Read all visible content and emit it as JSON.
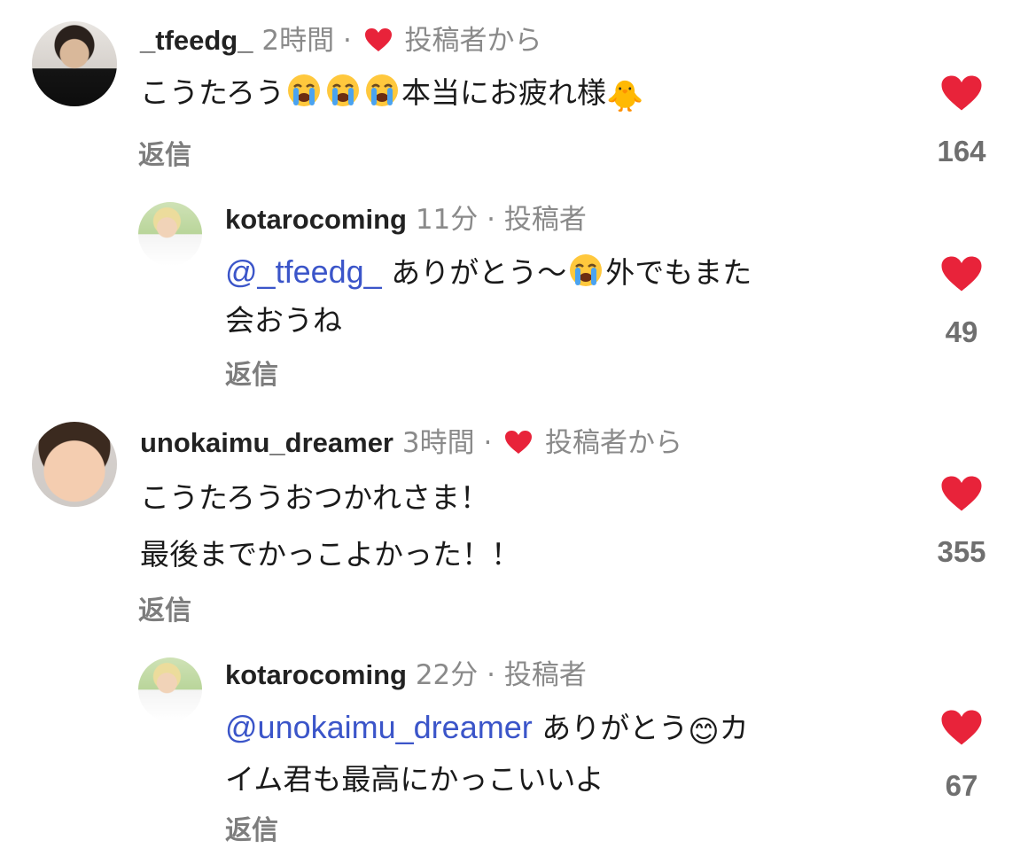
{
  "colors": {
    "heart": "#e8233a",
    "mention": "#3b55c9",
    "meta": "#8a8a8a"
  },
  "comments": [
    {
      "username": "_tfeedg_",
      "time": "2時間",
      "separator": "·",
      "creator_badge": "投稿者から",
      "text_before": "こうたろう",
      "text_after": "本当にお疲れ様",
      "emoji_tail": "🐥",
      "reply_label": "返信",
      "likes": "164"
    },
    {
      "username": "kotarocoming",
      "time": "11分",
      "separator": "·",
      "author_tag": "投稿者",
      "mention": "@_tfeedg_",
      "text_line1_a": "ありがとう〜",
      "text_line1_b": "外でもまた",
      "text_line2": "会おうね",
      "reply_label": "返信",
      "likes": "49"
    },
    {
      "username": "unokaimu_dreamer",
      "time": "3時間",
      "separator": "·",
      "creator_badge": "投稿者から",
      "text_line1": "こうたろうおつかれさま！",
      "text_line2": "最後までかっこよかった！！",
      "reply_label": "返信",
      "likes": "355"
    },
    {
      "username": "kotarocoming",
      "time": "22分",
      "separator": "·",
      "author_tag": "投稿者",
      "mention": "@unokaimu_dreamer",
      "text_line1_a": "ありがとう",
      "emoji": "😊",
      "text_line1_b": "カ",
      "text_line2": "イム君も最高にかっこいいよ",
      "reply_label": "返信",
      "likes": "67"
    }
  ]
}
